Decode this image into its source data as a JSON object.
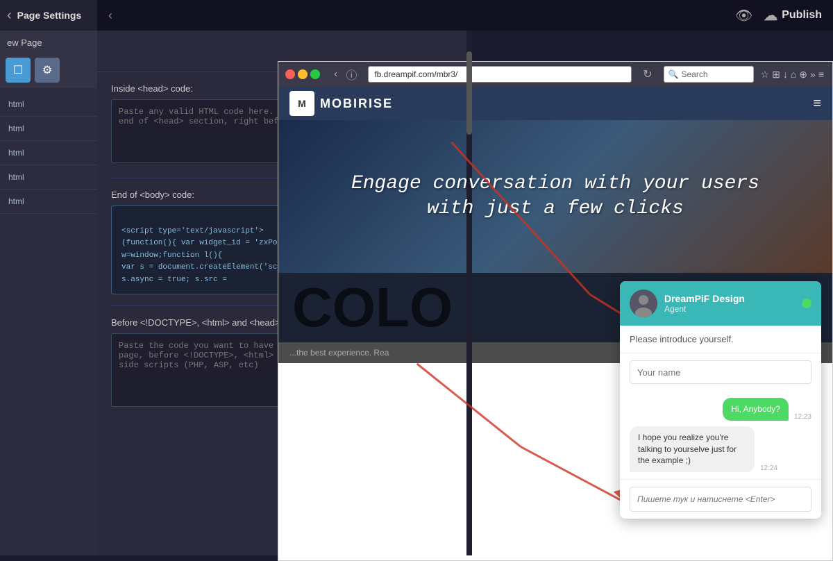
{
  "sidebar": {
    "back_label": "‹",
    "title": "Page Settings",
    "page_label": "ew Page",
    "icon_page": "☐",
    "icon_gear": "⚙",
    "items": [
      {
        "label": "html"
      },
      {
        "label": "html"
      },
      {
        "label": "html"
      },
      {
        "label": "html"
      },
      {
        "label": "html"
      }
    ]
  },
  "topbar": {
    "chevron": "‹",
    "title": "Page Settings",
    "eye_icon": "👁",
    "upload_icon": "☁",
    "publish_label": "Publish"
  },
  "page_settings": {
    "head_code_label": "Inside <head> code:",
    "head_code_placeholder": "Paste any valid HTML code here. The code will be inserted to the end of <head> section, right before </head>",
    "body_code_label": "End of <body> code:",
    "body_code_content": "<!-- BEGIN JIVOSITE CODE {literal} -->\n<script type='text/javascript'>\n(function(){ var widget_id = 'zxPolUKAXJ';var d=document;var\nw=window;function l(){\nvar s = document.createElement('script'); s.type = 'text/javascript';\ns.async = true; s.src =",
    "doctype_label": "Before <!DOCTYPE>, <html> and <head> tags:",
    "doctype_placeholder": "Paste the code you want to have in the VERY FIRST LINE of your page, before <!DOCTYPE>, <html> and <head> tags. Use for server side scripts (PHP, ASP, etc)"
  },
  "browser": {
    "url": "fb.dreampif.com/mbr3/",
    "search_placeholder": "Search",
    "hamburger": "≡"
  },
  "website": {
    "logo_letter": "M",
    "logo_name": "MOBIRISE",
    "hero_line1": "Engage conversation with your users",
    "hero_line2": "with just a few clicks",
    "bottom_text": "the best experience. Rea",
    "colo_text": "COLO"
  },
  "chat": {
    "agent_company": "DreamPiF Design",
    "agent_role": "Agent",
    "introduce_text": "Please introduce yourself.",
    "name_placeholder": "Your name",
    "close_icon": "×",
    "messages": [
      {
        "type": "sent",
        "text": "Hi, Anybody?",
        "time": "12:23"
      },
      {
        "type": "received",
        "text": "I hope you realize you're talking to yourselve just for the example ;)",
        "time": "12:24"
      }
    ],
    "input_placeholder": "Пишете тук и натиснете &lt;Enter&gt;"
  }
}
